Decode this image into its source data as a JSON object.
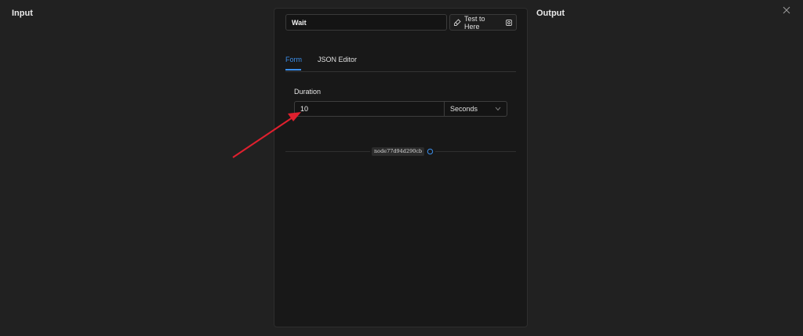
{
  "panels": {
    "input_title": "Input",
    "output_title": "Output"
  },
  "header": {
    "node_name": "Wait",
    "test_button_label": "Test to Here"
  },
  "tabs": [
    {
      "label": "Form",
      "active": true
    },
    {
      "label": "JSON Editor",
      "active": false
    }
  ],
  "form": {
    "duration_label": "Duration",
    "duration_value": "10",
    "unit_value": "Seconds"
  },
  "footer": {
    "node_id": "node77d94d290cb"
  },
  "colors": {
    "accent": "#3b8eea",
    "annotation_arrow": "#e0202e"
  }
}
